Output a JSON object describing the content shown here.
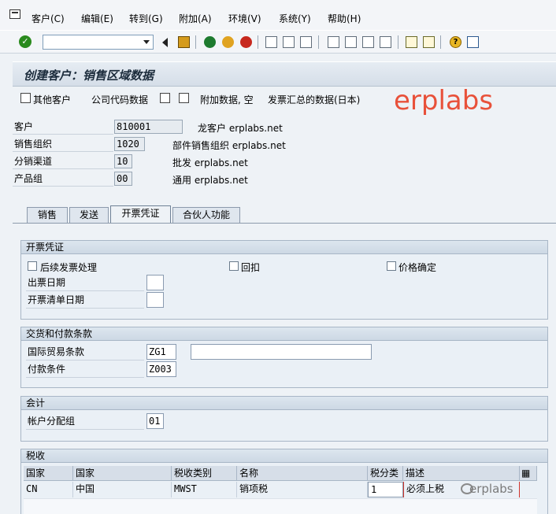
{
  "menu": [
    "客户(C)",
    "编辑(E)",
    "转到(G)",
    "附加(A)",
    "环境(V)",
    "系统(Y)",
    "帮助(H)"
  ],
  "window_title": "创建客户：销售区域数据",
  "app_toolbar": [
    "其他客户",
    "公司代码数据",
    "附加数据, 空",
    "发票汇总的数据(日本)"
  ],
  "watermark": "erplabs",
  "header": {
    "customer": {
      "label": "客户",
      "value": "810001",
      "desc": "龙客户 erplabs.net"
    },
    "sales_org": {
      "label": "销售组织",
      "value": "1020",
      "desc": "部件销售组织 erplabs.net"
    },
    "dist_channel": {
      "label": "分销渠道",
      "value": "10",
      "desc": "批发 erplabs.net"
    },
    "division": {
      "label": "产品组",
      "value": "00",
      "desc": "通用 erplabs.net"
    }
  },
  "tabs": [
    "销售",
    "发送",
    "开票凭证",
    "合伙人功能"
  ],
  "active_tab": "开票凭证",
  "billing": {
    "title": "开票凭证",
    "subsequent_invoice": "后续发票处理",
    "rebate": "回扣",
    "price_determination": "价格确定",
    "invoice_dates": "出票日期",
    "invoice_list_dates": "开票清单日期"
  },
  "delivery": {
    "title": "交货和付款条款",
    "incoterms_label": "国际贸易条款",
    "incoterms_value": "ZG1",
    "incoterms2_value": "",
    "payment_terms_label": "付款条件",
    "payment_terms_value": "Z003"
  },
  "accounting": {
    "title": "会计",
    "acct_group_label": "帐户分配组",
    "acct_group_value": "01"
  },
  "taxes": {
    "title": "税收",
    "columns": [
      "国家",
      "国家",
      "税收类别",
      "名称",
      "税分类",
      "描述"
    ],
    "rows": [
      [
        "CN",
        "中国",
        "MWST",
        "销项税",
        "1",
        "必须上税"
      ]
    ]
  },
  "footer_watermark": "erplabs"
}
